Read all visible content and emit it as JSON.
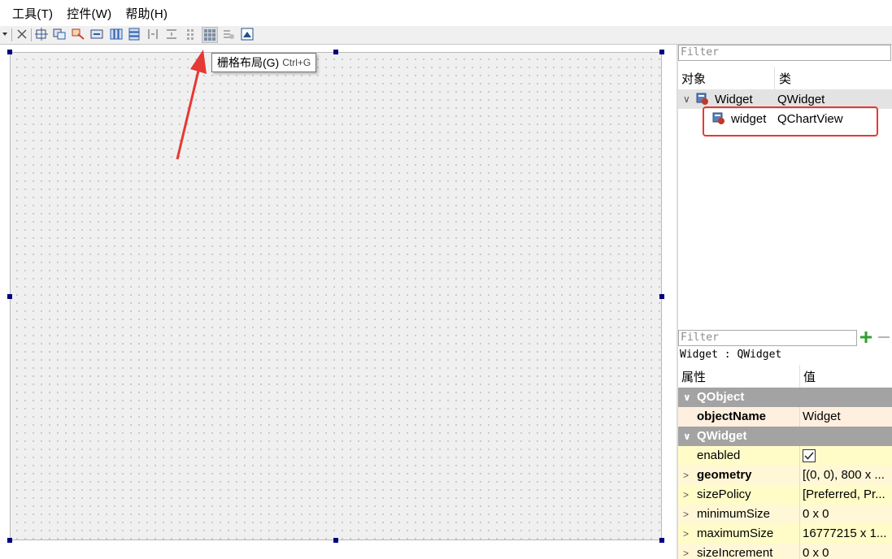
{
  "menu": {
    "tools": "工具(T)",
    "widgets": "控件(W)",
    "help": "帮助(H)"
  },
  "tooltip": {
    "label": "栅格布局(G)",
    "shortcut": "Ctrl+G"
  },
  "object_inspector": {
    "filter_placeholder": "Filter",
    "col_object": "对象",
    "col_class": "类",
    "rows": [
      {
        "object": "Widget",
        "class": "QWidget"
      },
      {
        "object": "widget",
        "class": "QChartView"
      }
    ]
  },
  "property_editor": {
    "filter_placeholder": "Filter",
    "context": "Widget : QWidget",
    "col_property": "属性",
    "col_value": "值",
    "groups": [
      {
        "name": "QObject"
      },
      {
        "name": "QWidget"
      }
    ],
    "rows": [
      {
        "name": "objectName",
        "value": "Widget"
      },
      {
        "name": "enabled",
        "value": ""
      },
      {
        "name": "geometry",
        "value": "[(0, 0), 800 x ..."
      },
      {
        "name": "sizePolicy",
        "value": "[Preferred, Pr..."
      },
      {
        "name": "minimumSize",
        "value": "0 x 0"
      },
      {
        "name": "maximumSize",
        "value": "16777215 x 1..."
      },
      {
        "name": "sizeIncrement",
        "value": "0 x 0"
      }
    ]
  },
  "colors": {
    "group_bg": "#a3a3a3",
    "selected_row": "#ffefdf",
    "yellow_row": "#fffcc8",
    "annotation_red": "#e53935",
    "handle": "#000080"
  }
}
